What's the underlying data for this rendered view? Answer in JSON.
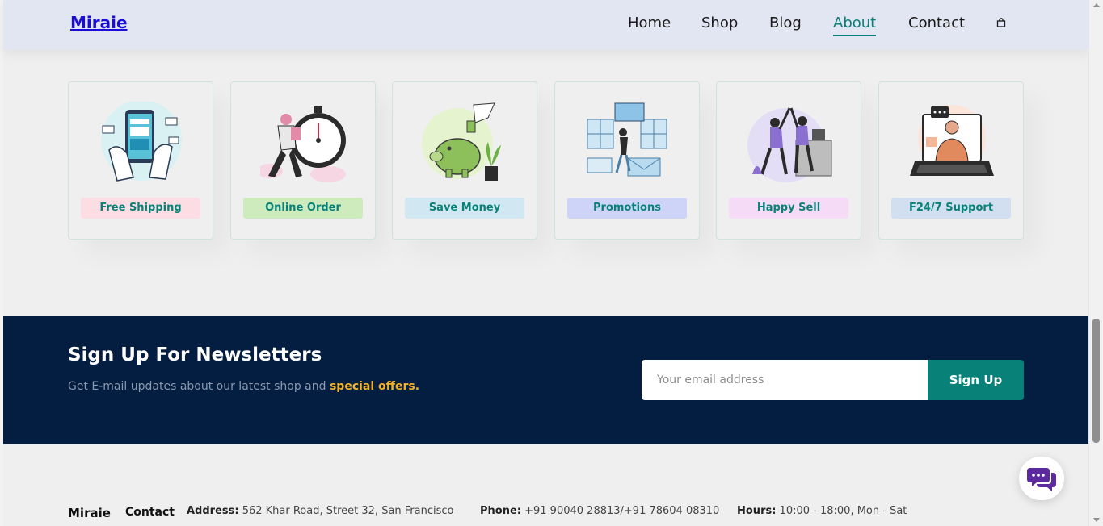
{
  "header": {
    "logo": "Miraie",
    "nav": [
      {
        "label": "Home"
      },
      {
        "label": "Shop"
      },
      {
        "label": "Blog"
      },
      {
        "label": "About",
        "active": true
      },
      {
        "label": "Contact"
      }
    ],
    "cart_icon": "shopping-bag-icon"
  },
  "features": [
    {
      "label": "Free Shipping",
      "color": "#fddde4",
      "icon": "payment-phone-illustration"
    },
    {
      "label": "Online Order",
      "color": "#cdebbc",
      "icon": "stopwatch-runner-illustration"
    },
    {
      "label": "Save Money",
      "color": "#d1e8f2",
      "icon": "piggy-bank-illustration"
    },
    {
      "label": "Promotions",
      "color": "#cdd4f8",
      "icon": "promotions-illustration"
    },
    {
      "label": "Happy Sell",
      "color": "#f6dbf6",
      "icon": "high-five-illustration"
    },
    {
      "label": "F24/7 Support",
      "color": "#fff2e5",
      "icon": "support-laptop-illustration"
    }
  ],
  "newsletter": {
    "title": "Sign Up For Newsletters",
    "subtitle": "Get E-mail updates about our latest shop and ",
    "highlight": "special offers.",
    "email_placeholder": "Your email address",
    "button": "Sign Up"
  },
  "footer": {
    "brand": "Miraie",
    "contact_heading": "Contact",
    "address_label": "Address:",
    "address": " 562 Khar Road, Street 32, San Francisco",
    "phone_label": "Phone:",
    "phone": " +91 90040 28813/+91 78604 08310",
    "hours_label": "Hours:",
    "hours": " 10:00 - 18:00, Mon - Sat"
  },
  "chat": {
    "icon": "chat-bubbles-icon"
  },
  "colors": {
    "accent": "#088178",
    "navy": "#041e42",
    "highlight": "#f2b126"
  }
}
